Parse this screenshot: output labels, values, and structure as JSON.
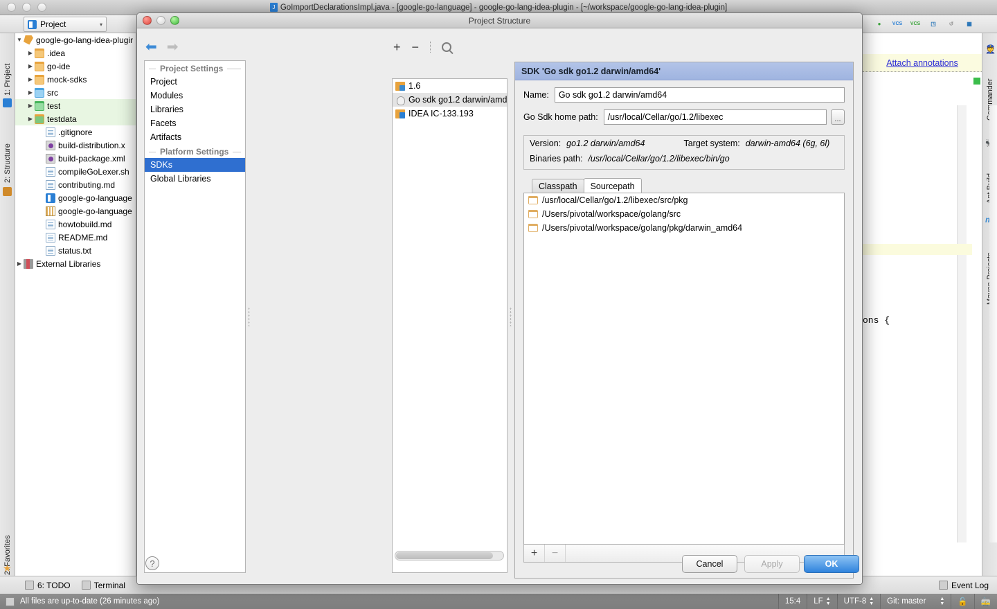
{
  "ide": {
    "title": "GoImportDeclarationsImpl.java - [google-go-language] - google-go-lang-idea-plugin - [~/workspace/google-go-lang-idea-plugin]",
    "project_tab": "Project",
    "project_tab_caret": "▾",
    "left_tabs": [
      {
        "label": "1: Project",
        "icon": "project-icon"
      },
      {
        "label": "2: Structure",
        "icon": "structure-icon"
      },
      {
        "label": "2: Favorites",
        "icon": "star-icon"
      }
    ],
    "right_tabs": [
      {
        "label": "Commander",
        "icon": "commander-icon"
      },
      {
        "label": "Ant Build",
        "icon": "ant-icon"
      },
      {
        "label": "Maven Projects",
        "icon": "maven-icon"
      }
    ],
    "tree": [
      {
        "label": "google-go-lang-idea-plugin",
        "indent": 0,
        "arrow": "▼",
        "icon": "plugin-icon",
        "green": false
      },
      {
        "label": ".idea",
        "indent": 1,
        "arrow": "▶",
        "icon": "folder",
        "green": false
      },
      {
        "label": "go-ide",
        "indent": 1,
        "arrow": "▶",
        "icon": "folder",
        "green": false
      },
      {
        "label": "mock-sdks",
        "indent": 1,
        "arrow": "▶",
        "icon": "folder",
        "green": false
      },
      {
        "label": "src",
        "indent": 1,
        "arrow": "▶",
        "icon": "folder-blue",
        "green": false
      },
      {
        "label": "test",
        "indent": 1,
        "arrow": "▶",
        "icon": "folder-green",
        "green": true
      },
      {
        "label": "testdata",
        "indent": 1,
        "arrow": "▶",
        "icon": "folder-test",
        "green": true
      },
      {
        "label": ".gitignore",
        "indent": 2,
        "arrow": "",
        "icon": "doc",
        "green": false
      },
      {
        "label": "build-distribution.x",
        "indent": 2,
        "arrow": "",
        "icon": "xml",
        "green": false
      },
      {
        "label": "build-package.xml",
        "indent": 2,
        "arrow": "",
        "icon": "xml",
        "green": false
      },
      {
        "label": "compileGoLexer.sh",
        "indent": 2,
        "arrow": "",
        "icon": "doc",
        "green": false
      },
      {
        "label": "contributing.md",
        "indent": 2,
        "arrow": "",
        "icon": "doc",
        "green": false
      },
      {
        "label": "google-go-language",
        "indent": 2,
        "arrow": "",
        "icon": "java",
        "green": false
      },
      {
        "label": "google-go-language",
        "indent": 2,
        "arrow": "",
        "icon": "iml",
        "green": false
      },
      {
        "label": "howtobuild.md",
        "indent": 2,
        "arrow": "",
        "icon": "doc",
        "green": false
      },
      {
        "label": "README.md",
        "indent": 2,
        "arrow": "",
        "icon": "doc",
        "green": false
      },
      {
        "label": "status.txt",
        "indent": 2,
        "arrow": "",
        "icon": "doc",
        "green": false
      },
      {
        "label": "External Libraries",
        "indent": 0,
        "arrow": "▶",
        "icon": "lib",
        "green": false
      }
    ],
    "toolbar_icons": [
      "debug-icon",
      "vcs-update-icon",
      "vcs-commit-icon",
      "history-icon",
      "undo-icon",
      "settings-icon"
    ],
    "vcs_update_label": "VCS",
    "vcs_commit_label": "VCS",
    "annotations_link": "Attach annotations",
    "editor_snippet": "ons {",
    "bottom_tabs": [
      {
        "label": "6: TODO",
        "icon": "todo-icon",
        "underline": "6"
      },
      {
        "label": "Terminal",
        "icon": "terminal-icon",
        "underline": ""
      }
    ],
    "event_log": "Event Log",
    "status": {
      "message": "All files are up-to-date (26 minutes ago)",
      "caret": "15:4",
      "line_sep": "LF",
      "encoding": "UTF-8",
      "branch": "Git: master",
      "lock_icon": "lock-icon",
      "train_icon": "train-icon"
    }
  },
  "dialog": {
    "title": "Project Structure",
    "nav": {
      "back": "⬅",
      "forward": "➡"
    },
    "sdk_toolbar": {
      "add": "+",
      "remove": "−",
      "search": "search-icon"
    },
    "settings": {
      "groups": [
        {
          "header": "Project Settings",
          "items": [
            {
              "label": "Project",
              "selected": false
            },
            {
              "label": "Modules",
              "selected": false
            },
            {
              "label": "Libraries",
              "selected": false
            },
            {
              "label": "Facets",
              "selected": false
            },
            {
              "label": "Artifacts",
              "selected": false
            }
          ]
        },
        {
          "header": "Platform Settings",
          "items": [
            {
              "label": "SDKs",
              "selected": true
            },
            {
              "label": "Global Libraries",
              "selected": false
            }
          ]
        }
      ]
    },
    "sdk_list": [
      {
        "label": "1.6",
        "icon": "jdk-icon",
        "selected": false
      },
      {
        "label": "Go sdk go1.2 darwin/amd",
        "icon": "go-sdk-icon",
        "selected": true
      },
      {
        "label": "IDEA IC-133.193",
        "icon": "idea-sdk-icon",
        "selected": false
      }
    ],
    "detail": {
      "header": "SDK 'Go sdk go1.2 darwin/amd64'",
      "name_label": "Name:",
      "name_value": "Go sdk go1.2 darwin/amd64",
      "home_label": "Go Sdk home path:",
      "home_value": "/usr/local/Cellar/go/1.2/libexec",
      "browse_label": "...",
      "info": {
        "version_label": "Version:",
        "version_value": "go1.2 darwin/amd64",
        "target_label": "Target system:",
        "target_value": "darwin-amd64 (6g, 6l)",
        "binaries_label": "Binaries path:",
        "binaries_value": "/usr/local/Cellar/go/1.2/libexec/bin/go"
      },
      "tabs": [
        {
          "label": "Classpath",
          "active": false
        },
        {
          "label": "Sourcepath",
          "active": true
        }
      ],
      "paths": [
        "/usr/local/Cellar/go/1.2/libexec/src/pkg",
        "/Users/pivotal/workspace/golang/src",
        "/Users/pivotal/workspace/golang/pkg/darwin_amd64"
      ],
      "path_toolbar": {
        "add": "+",
        "remove": "−"
      }
    },
    "footer": {
      "help": "?",
      "cancel": "Cancel",
      "apply": "Apply",
      "ok": "OK"
    }
  },
  "colors": {
    "accent_blue": "#2f6fd0",
    "ok_blue": "#2f83dd",
    "header_blue": "#9fb4e0",
    "link_purple": "#2c2cd6",
    "test_green": "#e8f6e2"
  }
}
